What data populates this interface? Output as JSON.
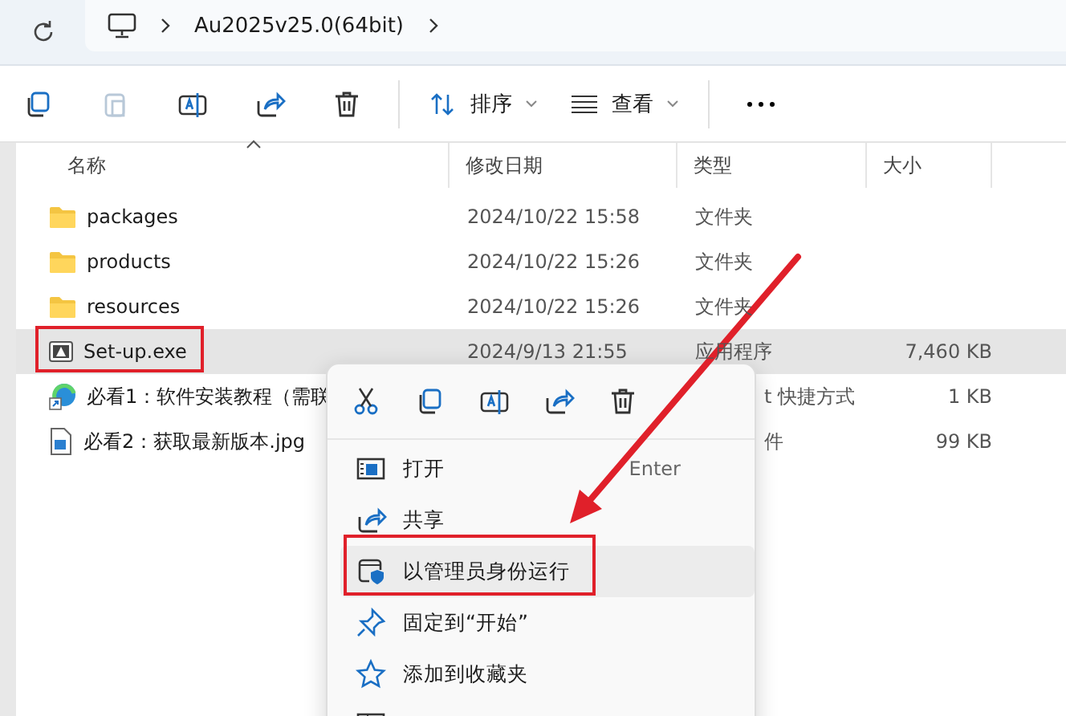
{
  "address_bar": {
    "path": [
      "Au2025v25.0(64bit)"
    ]
  },
  "toolbar": {
    "icon_buttons": [
      {
        "kind": "copy",
        "disabled": false
      },
      {
        "kind": "paste",
        "disabled": true
      },
      {
        "kind": "rename",
        "disabled": false
      },
      {
        "kind": "share",
        "disabled": false
      },
      {
        "kind": "delete",
        "disabled": false
      }
    ],
    "sort": "排序",
    "view": "查看"
  },
  "columns": [
    "名称",
    "修改日期",
    "类型",
    "大小"
  ],
  "rows": [
    {
      "kind": "folder",
      "name": "packages",
      "date": "2024/10/22 15:58",
      "type": "文件夹",
      "selected": false
    },
    {
      "kind": "folder",
      "name": "products",
      "date": "2024/10/22 15:26",
      "type": "文件夹",
      "selected": false
    },
    {
      "kind": "folder",
      "name": "resources",
      "date": "2024/10/22 15:26",
      "type": "文件夹",
      "selected": false
    },
    {
      "kind": "app",
      "name": "Set-up.exe",
      "date": "2024/9/13 21:55",
      "type": "应用程序",
      "size": "7,460 KB",
      "selected": true
    },
    {
      "kind": "shortcut",
      "name": "必看1：软件安装教程（需联",
      "type": "t 快捷方式",
      "size": "1 KB",
      "selected": false
    },
    {
      "kind": "image",
      "name": "必看2：获取最新版本.jpg",
      "type": "件",
      "size": "99 KB",
      "selected": false
    }
  ],
  "context_menu": {
    "quick_actions": [
      {
        "kind": "cut"
      },
      {
        "kind": "copy"
      },
      {
        "kind": "rename"
      },
      {
        "kind": "share"
      },
      {
        "kind": "delete"
      }
    ],
    "items": [
      {
        "kind": "open",
        "label": "打开",
        "shortcut": "Enter",
        "selected": false
      },
      {
        "kind": "share",
        "label": "共享",
        "selected": false
      },
      {
        "kind": "admin",
        "label": "以管理员身份运行",
        "selected": true
      },
      {
        "kind": "pin",
        "label": "固定到“开始”",
        "selected": false
      },
      {
        "kind": "favorite",
        "label": "添加到收藏夹",
        "selected": false
      },
      {
        "kind": "compress",
        "selected": false
      }
    ]
  }
}
